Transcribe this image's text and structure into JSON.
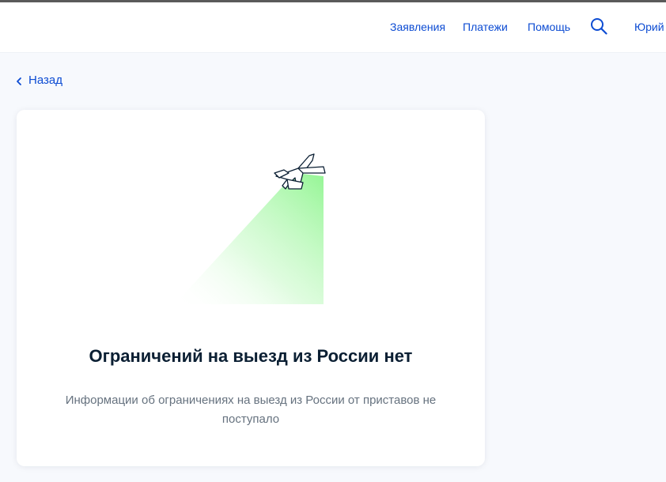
{
  "header": {
    "nav": [
      {
        "label": "Заявления"
      },
      {
        "label": "Платежи"
      },
      {
        "label": "Помощь"
      }
    ],
    "search_icon": "search-icon",
    "user_name": "Юрий"
  },
  "back": {
    "label": "Назад",
    "icon": "chevron-left-icon"
  },
  "card": {
    "illustration": "airplane-icon",
    "title": "Ограничений на выезд из России нет",
    "subtitle": "Информации об ограничениях на выезд из России от приставов не поступало"
  },
  "colors": {
    "link": "#0d4cd3",
    "background": "#f7f9fd",
    "title": "#0b1f33",
    "subtitle": "#66727f",
    "beam": "#8ff58f"
  }
}
